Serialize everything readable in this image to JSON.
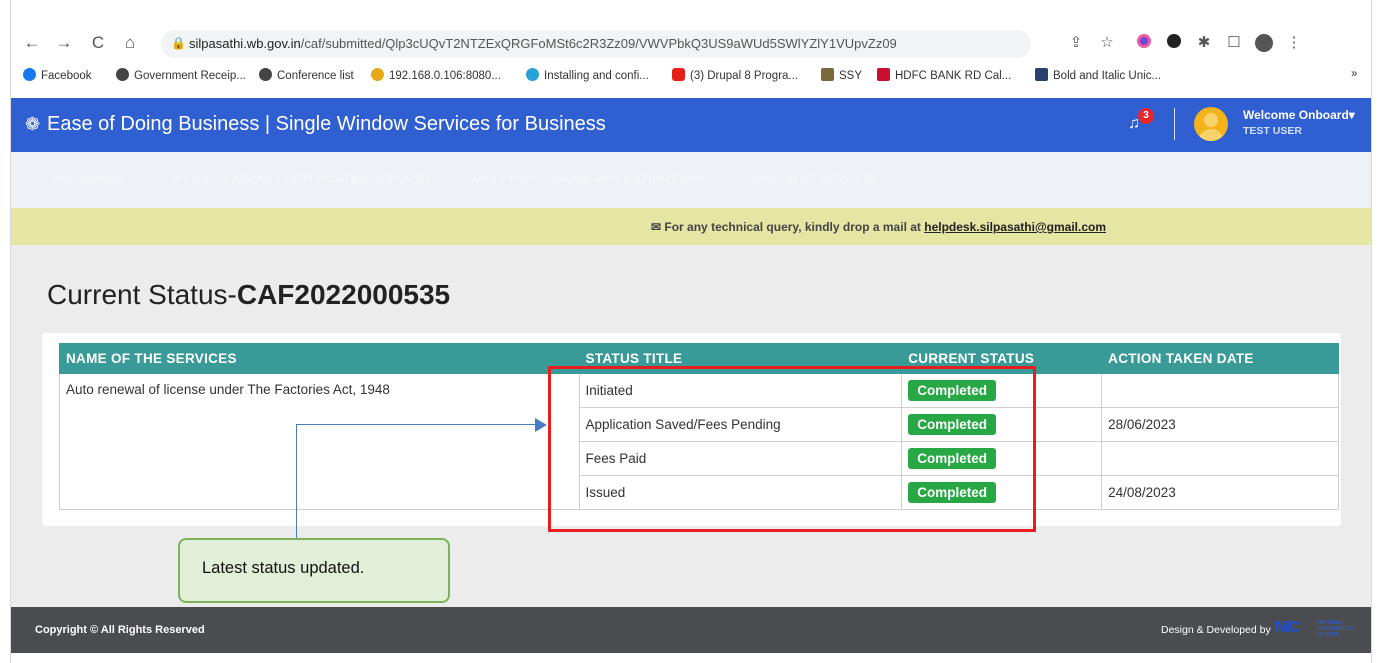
{
  "browser": {
    "url_domain": "silpasathi.wb.gov.in",
    "url_path": "/caf/submitted/Qlp3cUQvT2NTZExQRGFoMSt6c2R3Zz09/VWVPbkQ3US9aWUd5SWlYZlY1VUpvZz09",
    "nav_back": "←",
    "nav_forward": "→",
    "nav_reload": "C",
    "nav_home": "⌂",
    "bookmarks": [
      {
        "label": "Facebook",
        "color": "#1877f2"
      },
      {
        "label": "Government Receip...",
        "color": "#444444"
      },
      {
        "label": "Conference list",
        "color": "#444444"
      },
      {
        "label": "192.168.0.106:8080...",
        "color": "#e6a817"
      },
      {
        "label": "Installing and confi...",
        "color": "#2aa0d8"
      },
      {
        "label": "(3) Drupal 8 Progra...",
        "color": "#e62117"
      },
      {
        "label": "SSY",
        "color": "#7a6a3a"
      },
      {
        "label": "HDFC BANK RD Cal...",
        "color": "#c8102e"
      },
      {
        "label": "Bold and Italic Unic...",
        "color": "#2a3f6d"
      }
    ],
    "bookmarks_more": "»"
  },
  "header": {
    "title": "Ease of Doing Business | Single Window Services for Business",
    "notification_count": "3",
    "welcome": "Welcome Onboard",
    "user": "TEST USER"
  },
  "menu": {
    "items": [
      "DASHBOARD",
      "MY APPLICATIONS / CERTIFICATES",
      "ALL SERVICES",
      "APPLY FOR COMMON APPLICATION FORM",
      "SPECIALIST SERVICES"
    ]
  },
  "notice": {
    "prefix": "For any technical query, kindly drop a mail at ",
    "email": "helpdesk.silpasathi@gmail.com"
  },
  "page": {
    "title_prefix": "Current Status-",
    "caf_id": "CAF2022000535"
  },
  "table": {
    "headers": [
      "NAME OF THE SERVICES",
      "STATUS TITLE",
      "CURRENT STATUS",
      "ACTION TAKEN DATE"
    ],
    "service_name": "Auto renewal of license under The Factories Act, 1948",
    "rows": [
      {
        "status_title": "Initiated",
        "current_status": "Completed",
        "date": ""
      },
      {
        "status_title": "Application Saved/Fees Pending",
        "current_status": "Completed",
        "date": "28/06/2023"
      },
      {
        "status_title": "Fees Paid",
        "current_status": "Completed",
        "date": ""
      },
      {
        "status_title": "Issued",
        "current_status": "Completed",
        "date": "24/08/2023"
      }
    ]
  },
  "annotation": {
    "callout": "Latest status updated."
  },
  "footer": {
    "copyright": "Copyright © All Rights Reserved",
    "developed_by": "Design & Developed by",
    "logo": "NIC",
    "logo_sub": "NATIONAL INFORMATICS CENTRE"
  }
}
